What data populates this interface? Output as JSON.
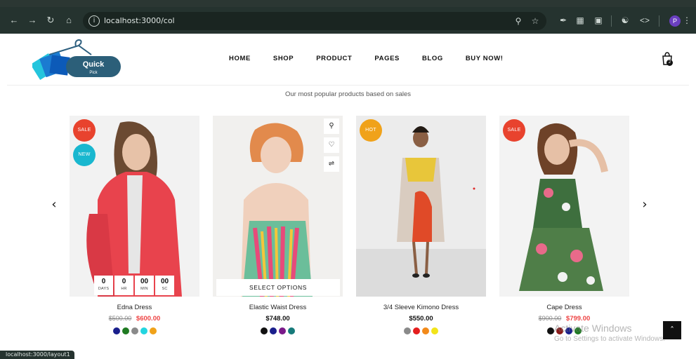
{
  "browser": {
    "url": "localhost:3000/col",
    "profile_initial": "P",
    "status_url": "localhost:3000/layout1"
  },
  "header": {
    "logo_text": "Quick",
    "logo_sub": "Pick",
    "nav": [
      "HOME",
      "SHOP",
      "PRODUCT",
      "PAGES",
      "BLOG",
      "BUY NOW!"
    ],
    "cart_count": "2"
  },
  "section": {
    "subtitle": "Our most popular products based on sales"
  },
  "products": [
    {
      "name": "Edna Dress",
      "old_price": "$500.00",
      "price": "$600.00",
      "badges": [
        "SALE",
        "NEW"
      ],
      "countdown": [
        {
          "value": "0",
          "label": "DAYS"
        },
        {
          "value": "0",
          "label": "HR"
        },
        {
          "value": "00",
          "label": "MIN"
        },
        {
          "value": "00",
          "label": "SC"
        }
      ],
      "swatches": [
        "#1a1f8c",
        "#1f7a22",
        "#8a8a8a",
        "#23d5e0",
        "#f0a21a"
      ]
    },
    {
      "name": "Elastic Waist Dress",
      "price": "$748.00",
      "select_options": "SELECT OPTIONS",
      "quick_actions": [
        "zoom-icon",
        "heart-icon",
        "shuffle-icon"
      ],
      "swatches": [
        "#111111",
        "#1a1f8c",
        "#7a1a8a",
        "#167a7a"
      ]
    },
    {
      "name": "3/4 Sleeve Kimono Dress",
      "price": "$550.00",
      "badges": [
        "HOT"
      ],
      "swatches": [
        "#8a8a8a",
        "#e41e1e",
        "#f28a1a",
        "#f2e41a"
      ]
    },
    {
      "name": "Cape Dress",
      "old_price": "$900.00",
      "price": "$799.00",
      "badges": [
        "SALE"
      ],
      "swatches": [
        "#111111",
        "#8a1a1a",
        "#1a1f8c",
        "#1f7a22"
      ]
    }
  ],
  "watermark": {
    "line1": "Activate Windows",
    "line2": "Go to Settings to activate Windows."
  },
  "colors": {
    "sale": "#e8432e",
    "new": "#19b7cf",
    "hot": "#f0a21a",
    "price_red": "#e44444",
    "chrome": "#25332f"
  }
}
